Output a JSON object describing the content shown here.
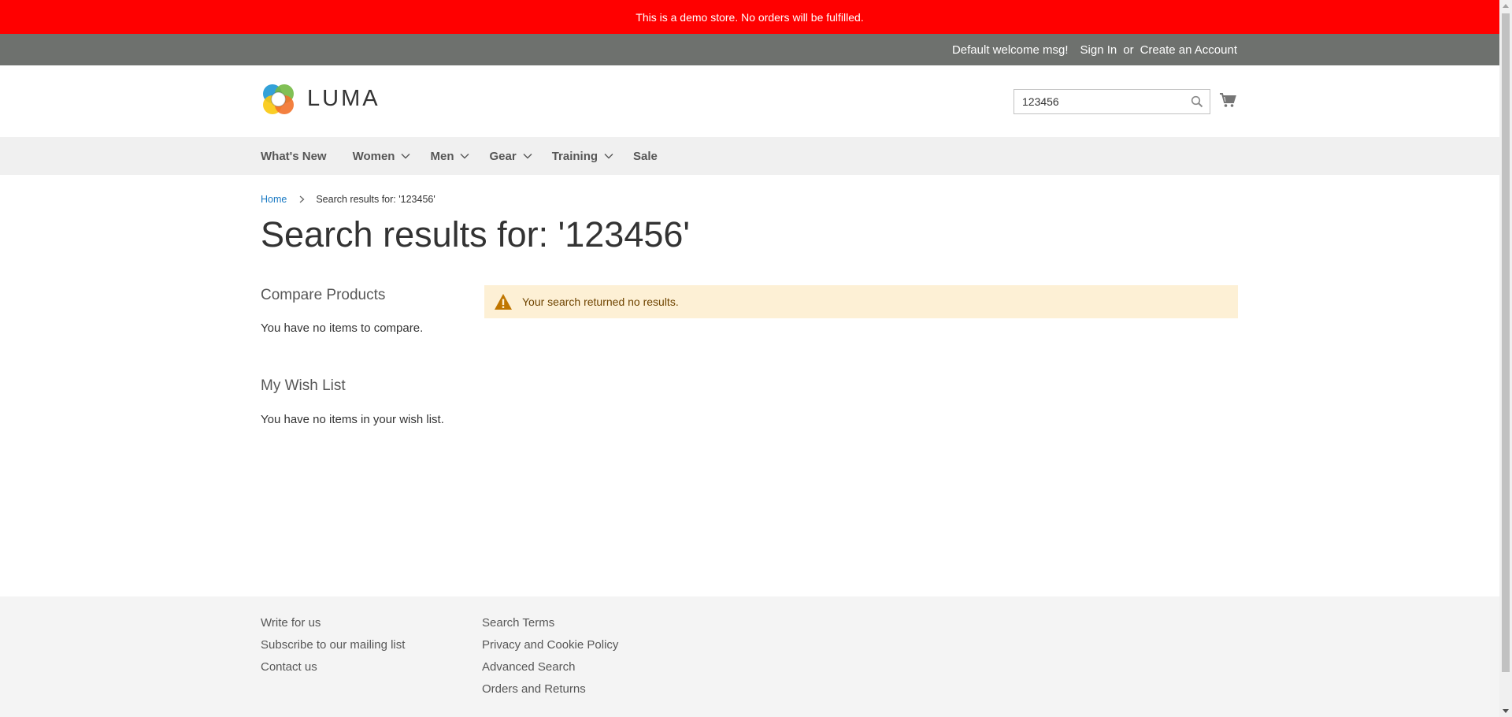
{
  "demo_notice": "This is a demo store. No orders will be fulfilled.",
  "top_links": {
    "welcome": "Default welcome msg!",
    "sign_in": "Sign In",
    "or": "or",
    "create_account": "Create an Account"
  },
  "header": {
    "logo_text": "LUMA",
    "search_value": "123456",
    "search_icon": "search-icon",
    "cart_icon": "cart-icon"
  },
  "nav": {
    "items": [
      {
        "label": "What's New",
        "has_dropdown": false
      },
      {
        "label": "Women",
        "has_dropdown": true
      },
      {
        "label": "Men",
        "has_dropdown": true
      },
      {
        "label": "Gear",
        "has_dropdown": true
      },
      {
        "label": "Training",
        "has_dropdown": true
      },
      {
        "label": "Sale",
        "has_dropdown": false
      }
    ]
  },
  "breadcrumbs": {
    "home": "Home",
    "current": "Search results for: '123456'"
  },
  "page_title": "Search results for: '123456'",
  "sidebar": {
    "compare_title": "Compare Products",
    "compare_text": "You have no items to compare.",
    "wishlist_title": "My Wish List",
    "wishlist_text": "You have no items in your wish list."
  },
  "message": {
    "icon": "warning-icon",
    "text": "Your search returned no results."
  },
  "footer": {
    "col1": [
      "Write for us",
      "Subscribe to our mailing list",
      "Contact us"
    ],
    "col2": [
      "Search Terms",
      "Privacy and Cookie Policy",
      "Advanced Search",
      "Orders and Returns"
    ]
  },
  "colors": {
    "demo_notice_bg": "#ff0000",
    "top_bar_bg": "#6e716e",
    "link": "#1979c3",
    "warning_bg": "#fdf0d5",
    "warning_icon": "#c07600"
  }
}
